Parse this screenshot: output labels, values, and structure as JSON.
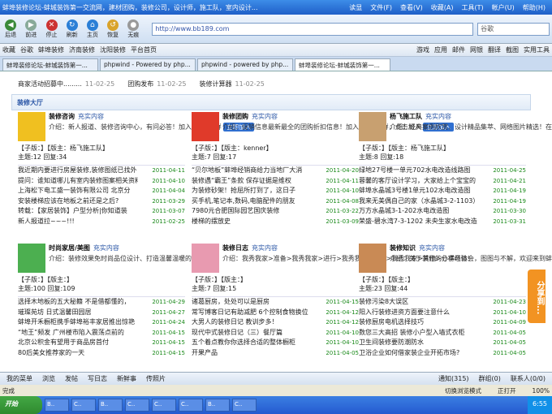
{
  "window": {
    "title": "蚌埠装修论坛-蚌城装饰第一交流网，建材团购，装修公司，设计师，施工队，室内设计...",
    "menu": [
      "读显",
      "文件(F)",
      "查看(V)",
      "收藏(A)",
      "工具(T)",
      "帐户(U)",
      "帮助(H)"
    ]
  },
  "toolbar": {
    "buttons": [
      "后退",
      "前进",
      "停止",
      "刷新",
      "主页",
      "恢复",
      "无痕"
    ],
    "address": "http://www.bb189.com",
    "search": "谷歌"
  },
  "favorites": [
    "收藏",
    "谷歌",
    "蚌埠装修",
    "济南装修",
    "沈阳装修",
    "平台首页",
    "游戏",
    "应用",
    "邮件",
    "网银",
    "翻译",
    "截图",
    "实用工具"
  ],
  "tabs": [
    "蚌埠装修论坛-蚌城装饰第一...",
    "phpwind - Powered by php...",
    "phpwind - powered by php...",
    "蚌埠装修论坛-蚌城装饰第一..."
  ],
  "news": [
    {
      "t": "商家活动招募中.........",
      "d": "11-02-25"
    },
    {
      "t": "团购发布",
      "d": "11-02-25"
    },
    {
      "t": "装修计算器",
      "d": "11-02-25"
    }
  ],
  "hall": "装修大厅",
  "panels": [
    {
      "title": "装修咨询",
      "fill": "充实内容",
      "desc": "介绍：新人报道、装修咨询中心，有问必答！加入我们QQ群",
      "join": "立即加入",
      "role": "【子版：】【版主：杨飞施工队】",
      "stat": "主题:12 回复:34",
      "items": [
        [
          "我近期内要进行房屋装修,装修图纸已找外",
          "2011-04-11"
        ],
        [
          "提问：谁知道哪儿有室内装修图案相关资料",
          "2011-04-10"
        ],
        [
          "上海松下电工盛一装饰有限公司 北京分",
          "2011-04-04"
        ],
        [
          "安装楼梯应该在地板之前还是之后?",
          "2011-03-29"
        ],
        [
          "转载：【家居装饰】户型分析|你知道装",
          "2011-03-07"
        ],
        [
          "新人报道拉~~~!!!",
          "2011-02-25"
        ]
      ]
    },
    {
      "title": "装修团购",
      "fill": "充实内容",
      "desc": "介绍：促销信息最新最全的团购折扣信息！加入QQ团购群，点击加入",
      "join": "立即加入",
      "role": "【子版：】【版主：kenner】",
      "stat": "主题:7 回复:17",
      "items": [
        [
          "“贝尔地板”蚌埠经销商给力当地厂大消",
          "2011-04-20"
        ],
        [
          "装修遇“霸王”条款 保存证据是维权",
          "2011-04-11"
        ],
        [
          "为装修砂架！抢屈所打到了，这日子",
          "2011-04-10"
        ],
        [
          "买手机,笔记本,数码,电脑配件的朋友",
          "2011-04-08"
        ],
        [
          "7980元合肥国际园艺国庆装修",
          "2011-03-22"
        ],
        [
          "楼梯的摆放史",
          "2011-03-09"
        ]
      ]
    },
    {
      "title": "杨飞施工队",
      "fill": "充实内容",
      "desc": "介绍：经典案例欣赏、设计精品集萃、网络图片精选！在线QQ交流！",
      "join": "在线咨询",
      "role": "【子版：】【版主：杨飞施工队】",
      "stat": "主题:8 回复:18",
      "items": [
        [
          "绿地27号楼一单元702水电改造线路图",
          "2011-04-25"
        ],
        [
          "蓉馨的客厅设计学习，大家给上个宝宝的",
          "2011-04-21"
        ],
        [
          "蚌埠水晶城3号楼1单元102水电改造图",
          "2011-04-19"
        ],
        [
          "我来无美偶自己的家（水晶城3-2-1103）",
          "2011-04-19"
        ],
        [
          "万方水晶城3-1-202水电改造图",
          "2011-03-30"
        ],
        [
          "荣盛-碧水湾7-3-1202 未央生家水电改造",
          "2011-03-31"
        ]
      ]
    },
    {
      "title": "时尚家居/美图",
      "fill": "充实内容",
      "desc": "介绍：装修效果免时尚品位设计、打造温馨温暖的家！",
      "join": "",
      "role": "【子版：】【版主：】",
      "stat": "主题:100 回复:109",
      "items": [
        [
          "选择木地板的五大秘籍 不是借都懂的，",
          "2011-04-29"
        ],
        [
          "璀璨苑坊 日式温馨田园居",
          "2011-04-27"
        ],
        [
          "蚌埠开禾橱柜携手蚌埠裕丰家居推出惊艳",
          "2011-04-24"
        ],
        [
          "“地王”频发 广州楼市陷入震荡点前的",
          "2011-04-15"
        ],
        [
          "北京公积金有望用于商品房首付",
          "2011-04-15"
        ],
        [
          "80后美女推荐家的一天",
          "2011-04-15"
        ]
      ]
    },
    {
      "title": "装修日志",
      "fill": "充实内容",
      "desc": "介绍：我秀我家>准备>我秀我家>进行>我秀我家>完成>我秀我家>其他>分享经验！",
      "join": "",
      "role": "【子版：】【版主：】",
      "stat": "主题:7 回复:15",
      "items": [
        [
          "诸葛厨房，处处可以是厨房",
          "2011-04-15"
        ],
        [
          "常写博客日记有助减肥 6个控制食物换位",
          "2011-04-12"
        ],
        [
          "大男人的装修日记 教训步多！",
          "2011-04-12"
        ],
        [
          "现代中式装修日记（三）餐厅篇",
          "2011-04-10"
        ],
        [
          "五个着点教你你选择合适的整体橱柜",
          "2011-04-10"
        ],
        [
          "开果产品",
          "2011-04-05"
        ]
      ]
    },
    {
      "title": "装修知识",
      "fill": "充实内容",
      "desc": "介绍：关于装修的心得与体会，图图与不解，欢迎来到蚌埠装修论坛探讨。",
      "join": "",
      "role": "【子版：】【版主：】",
      "stat": "主题:23 回复:44",
      "items": [
        [
          "装修污染8大误区",
          "2011-04-23"
        ],
        [
          "阳入行装修进资方面要注意什么",
          "2011-04-10"
        ],
        [
          "装修厨房电机选择技巧",
          "2011-04-09"
        ],
        [
          "数您三大高招 装修小户型入墙式衣柜",
          "2011-04-05"
        ],
        [
          "卫生间装修要防潮防水",
          "2011-04-05"
        ],
        [
          "卫浴企业如何借家装企业开拓市场?",
          "2011-04-05"
        ]
      ]
    }
  ],
  "share": "分享到...",
  "bottom": [
    "我的菜单",
    "浏览",
    "发帖",
    "写日志",
    "新鲜事",
    "传照片",
    "通知(315)",
    "群组(0)",
    "联系人(0/0)"
  ],
  "status": {
    "left": "完成",
    "mid": "切换浏览模式",
    "right": "正打开",
    "zoom": "100%"
  },
  "taskbar": {
    "start": "开始",
    "tasks": [
      "B..",
      "C..",
      "B..",
      "C..",
      "C..",
      "C..",
      "B..",
      "C.."
    ],
    "time": "6:55"
  }
}
